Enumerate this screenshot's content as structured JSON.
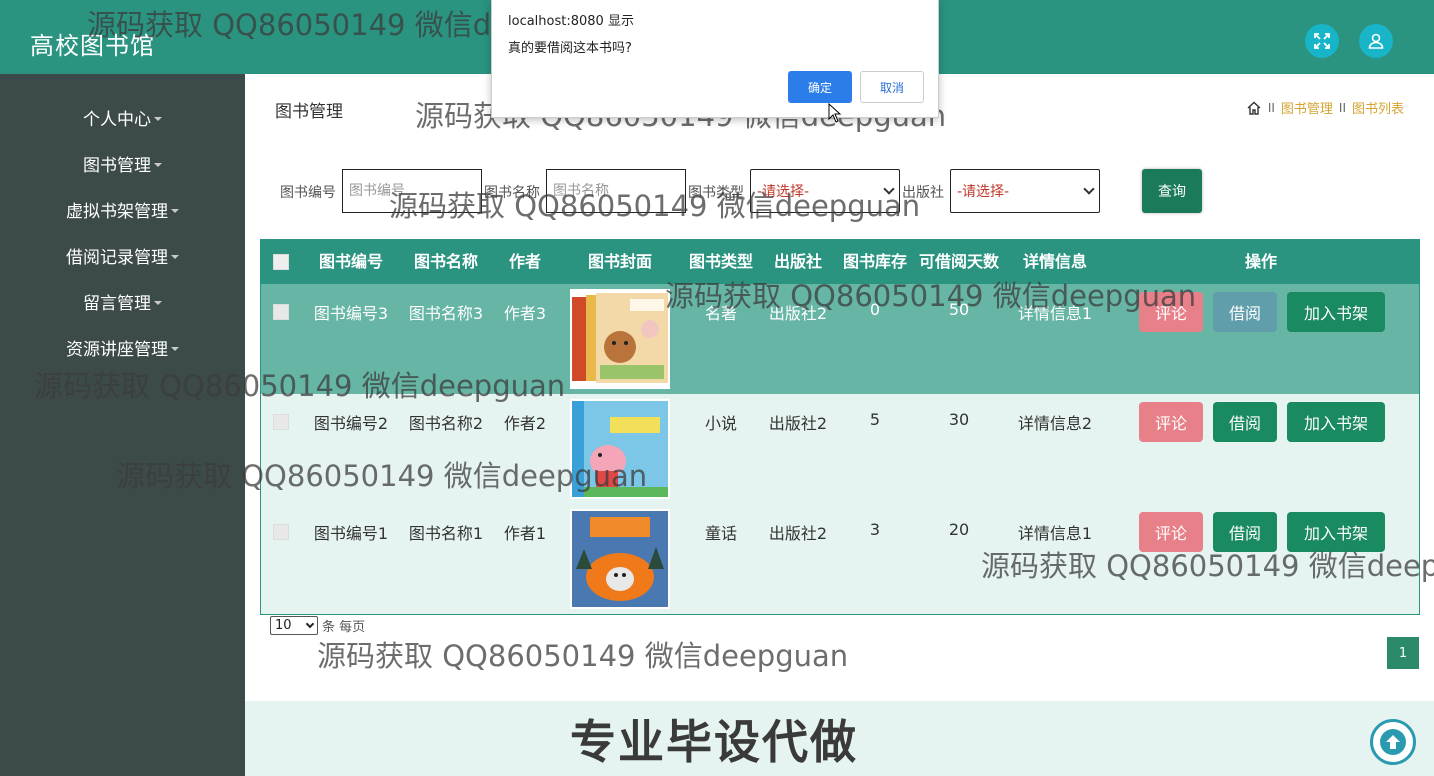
{
  "header": {
    "app_title": "高校图书馆",
    "fullscreen_icon": "expand-icon",
    "user_icon": "user-icon",
    "accent": "#2a9480"
  },
  "sidebar": {
    "items": [
      {
        "label": "个人中心"
      },
      {
        "label": "图书管理"
      },
      {
        "label": "虚拟书架管理"
      },
      {
        "label": "借阅记录管理"
      },
      {
        "label": "留言管理"
      },
      {
        "label": "资源讲座管理"
      }
    ]
  },
  "page": {
    "title": "图书管理",
    "breadcrumb": [
      "图书管理",
      "图书列表"
    ],
    "breadcrumb_sep": "II"
  },
  "search": {
    "book_no_label": "图书编号",
    "book_no_placeholder": "图书编号",
    "book_name_label": "图书名称",
    "book_name_placeholder": "图书名称",
    "book_type_label": "图书类型",
    "book_type_value": "-请选择-",
    "publisher_label": "出版社",
    "publisher_value": "-请选择-",
    "query_label": "查询"
  },
  "table": {
    "headers": [
      "图书编号",
      "图书名称",
      "作者",
      "图书封面",
      "图书类型",
      "出版社",
      "图书库存",
      "可借阅天数",
      "详情信息",
      "操作"
    ],
    "rows": [
      {
        "book_no": "图书编号3",
        "name": "图书名称3",
        "author": "作者3",
        "type": "名著",
        "publisher": "出版社2",
        "stock": "0",
        "days": "50",
        "detail": "详情信息1",
        "cover": "mama-cover"
      },
      {
        "book_no": "图书编号2",
        "name": "图书名称2",
        "author": "作者2",
        "type": "小说",
        "publisher": "出版社2",
        "stock": "5",
        "days": "30",
        "detail": "详情信息2",
        "cover": "peppa-cover"
      },
      {
        "book_no": "图书编号1",
        "name": "图书名称1",
        "author": "作者1",
        "type": "童话",
        "publisher": "出版社2",
        "stock": "3",
        "days": "20",
        "detail": "详情信息1",
        "cover": "pumpkin-cover"
      }
    ],
    "actions": {
      "review": "评论",
      "borrow": "借阅",
      "shelf": "加入书架"
    },
    "colors": {
      "row_selected": "#66b5a5",
      "row_normal": "#e6f4f1",
      "borrow_disabled": "#5f9eaa",
      "borrow_enabled": "#1a8a60",
      "review": "#e8808a"
    }
  },
  "pagination": {
    "page_size": "10",
    "per_page_label": "条 每页",
    "current_page": "1"
  },
  "footer": {
    "text": "专业毕设代做"
  },
  "dialog": {
    "origin": "localhost:8080 显示",
    "message": "真的要借阅这本书吗?",
    "ok_label": "确定",
    "cancel_label": "取消"
  },
  "watermark": {
    "text": "源码获取 QQ86050149 微信deepguan"
  }
}
